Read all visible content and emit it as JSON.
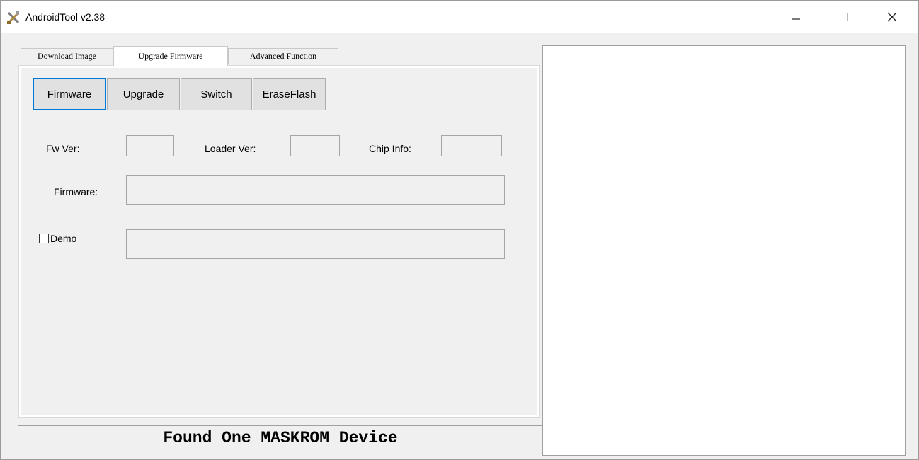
{
  "window": {
    "title": "AndroidTool v2.38",
    "icon": "tools-icon",
    "controls": {
      "minimize": "–",
      "maximize": "☐",
      "close": "✕"
    }
  },
  "tabs": [
    {
      "label": "Download Image",
      "active": false
    },
    {
      "label": "Upgrade Firmware",
      "active": true
    },
    {
      "label": "Advanced Function",
      "active": false
    }
  ],
  "toolbar": {
    "firmware_label": "Firmware",
    "upgrade_label": "Upgrade",
    "switch_label": "Switch",
    "eraseflash_label": "EraseFlash"
  },
  "info": {
    "fw_ver_label": "Fw Ver:",
    "fw_ver_value": "",
    "loader_ver_label": "Loader Ver:",
    "loader_ver_value": "",
    "chip_info_label": "Chip Info:",
    "chip_info_value": "",
    "firmware_label": "Firmware:",
    "firmware_value": "",
    "demo_label": "Demo",
    "demo_checked": false,
    "demo_value": ""
  },
  "status": {
    "text": "Found One MASKROM Device"
  },
  "log": {
    "text": ""
  }
}
